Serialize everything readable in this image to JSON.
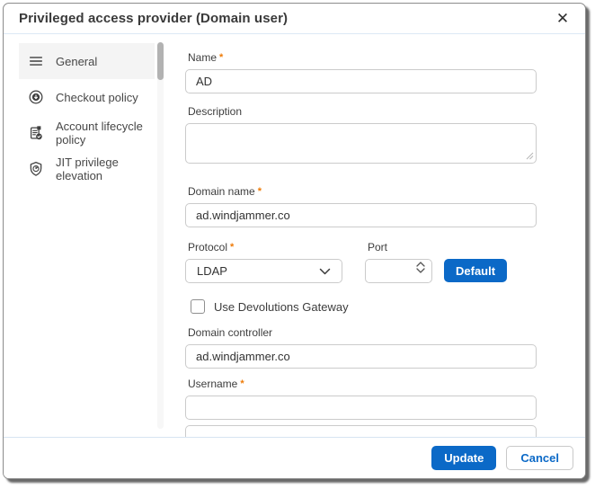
{
  "dialog": {
    "title": "Privileged access provider (Domain user)",
    "close_icon": "✕"
  },
  "sidebar": {
    "items": [
      {
        "label": "General",
        "icon": "menu-icon",
        "selected": true
      },
      {
        "label": "Checkout policy",
        "icon": "checkout-policy-icon",
        "selected": false
      },
      {
        "label": "Account lifecycle policy",
        "icon": "account-lifecycle-icon",
        "selected": false
      },
      {
        "label": "JIT privilege elevation",
        "icon": "shield-clock-icon",
        "selected": false
      }
    ]
  },
  "form": {
    "required_marker": "*",
    "name_label": "Name",
    "name_value": "AD",
    "description_label": "Description",
    "description_value": "",
    "domain_name_label": "Domain name",
    "domain_name_value": "ad.windjammer.co",
    "protocol_label": "Protocol",
    "protocol_value": "LDAP",
    "port_label": "Port",
    "port_value": "",
    "default_button_label": "Default",
    "gateway_checkbox_label": "Use Devolutions Gateway",
    "gateway_checkbox_checked": false,
    "domain_controller_label": "Domain controller",
    "domain_controller_value": "ad.windjammer.co",
    "username_label": "Username",
    "username_value": ""
  },
  "footer": {
    "update_label": "Update",
    "cancel_label": "Cancel"
  },
  "colors": {
    "accent_blue": "#0b69c7",
    "required_orange": "#ee7b08",
    "separator_blue": "#dce9f5"
  }
}
